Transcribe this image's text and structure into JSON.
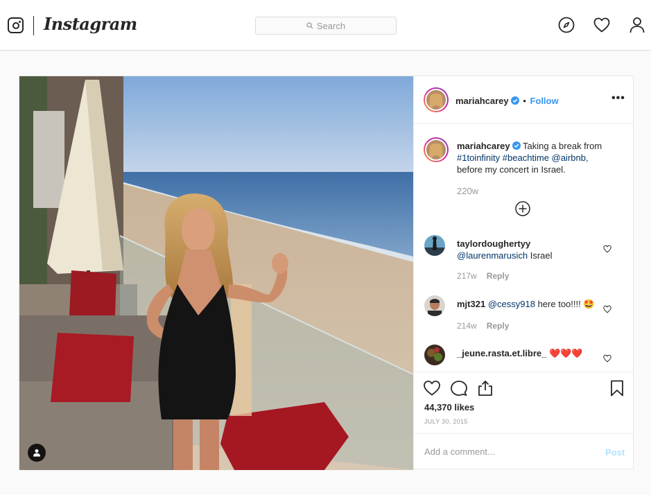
{
  "nav": {
    "wordmark": "Instagram",
    "search_placeholder": "Search",
    "icons": [
      "instagram-logo-icon",
      "explore-compass-icon",
      "activity-heart-icon",
      "profile-icon"
    ]
  },
  "post": {
    "username": "mariahcarey",
    "follow_separator": "•",
    "follow_label": "Follow",
    "more_label": "•••",
    "caption": {
      "username": "mariahcarey",
      "text_1": "Taking a break from",
      "tag_1": "#1toinfinity",
      "tag_2": "#beachtime",
      "tag_3": "@airbnb",
      "text_2": ",",
      "text_3": "before my concert in Israel.",
      "time": "220w"
    },
    "comments": [
      {
        "username": "taylordoughertyy",
        "mention": "@laurenmarusich",
        "text": "Israel",
        "time": "217w",
        "reply": "Reply"
      },
      {
        "username": "mjt321",
        "mention": "@cessy918",
        "text": "here too!!!! 🤩",
        "time": "214w",
        "reply": "Reply"
      },
      {
        "username": "_jeune.rasta.et.libre_",
        "mention": "",
        "text": "❤️❤️❤️",
        "time": "",
        "reply": ""
      }
    ],
    "likes": "44,370 likes",
    "date": "JULY 30, 2015",
    "add_comment_placeholder": "Add a comment...",
    "post_label": "Post",
    "colors": {
      "link_blue": "#3897f0",
      "hashtag": "#003569",
      "post_disabled": "#b2dffc",
      "verified": "#3897f0"
    }
  }
}
